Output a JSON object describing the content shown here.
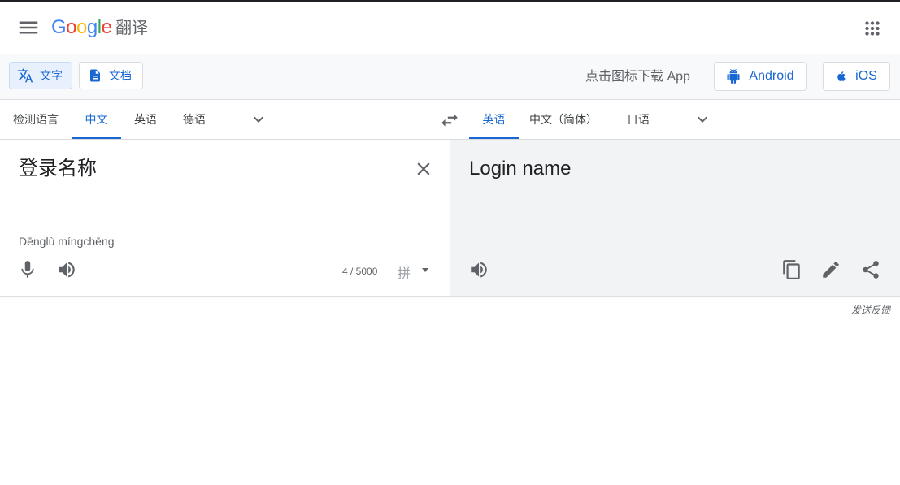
{
  "header": {
    "logo_letters": [
      "G",
      "o",
      "o",
      "g",
      "l",
      "e"
    ],
    "product": "翻译",
    "icons": {
      "menu": "hamburger-menu-icon",
      "apps": "apps-grid-icon"
    }
  },
  "toolbar": {
    "modes": [
      {
        "label": "文字",
        "icon": "translate-icon",
        "active": true
      },
      {
        "label": "文档",
        "icon": "document-icon",
        "active": false
      }
    ],
    "download_text": "点击图标下载 App",
    "stores": [
      {
        "label": "Android",
        "icon": "android-icon"
      },
      {
        "label": "iOS",
        "icon": "apple-icon"
      }
    ]
  },
  "source_langs": [
    "检测语言",
    "中文",
    "英语",
    "德语"
  ],
  "source_active": "中文",
  "target_langs": [
    "英语",
    "中文（简体）",
    "日语"
  ],
  "target_active": "英语",
  "source": {
    "text": "登录名称",
    "transliteration": "Dēnglù míngchēng",
    "char_count": "4 / 5000",
    "ime_label": "拼"
  },
  "target": {
    "text": "Login name"
  },
  "feedback": "发送反馈",
  "colors": {
    "accent": "#1967d2",
    "active_bg": "#e8f0fe",
    "target_panel_bg": "#f1f3f4",
    "text": "#3c4043",
    "google_blue": "#4285f4",
    "google_red": "#ea4335",
    "google_yellow": "#fbbc05",
    "google_green": "#34a853"
  }
}
